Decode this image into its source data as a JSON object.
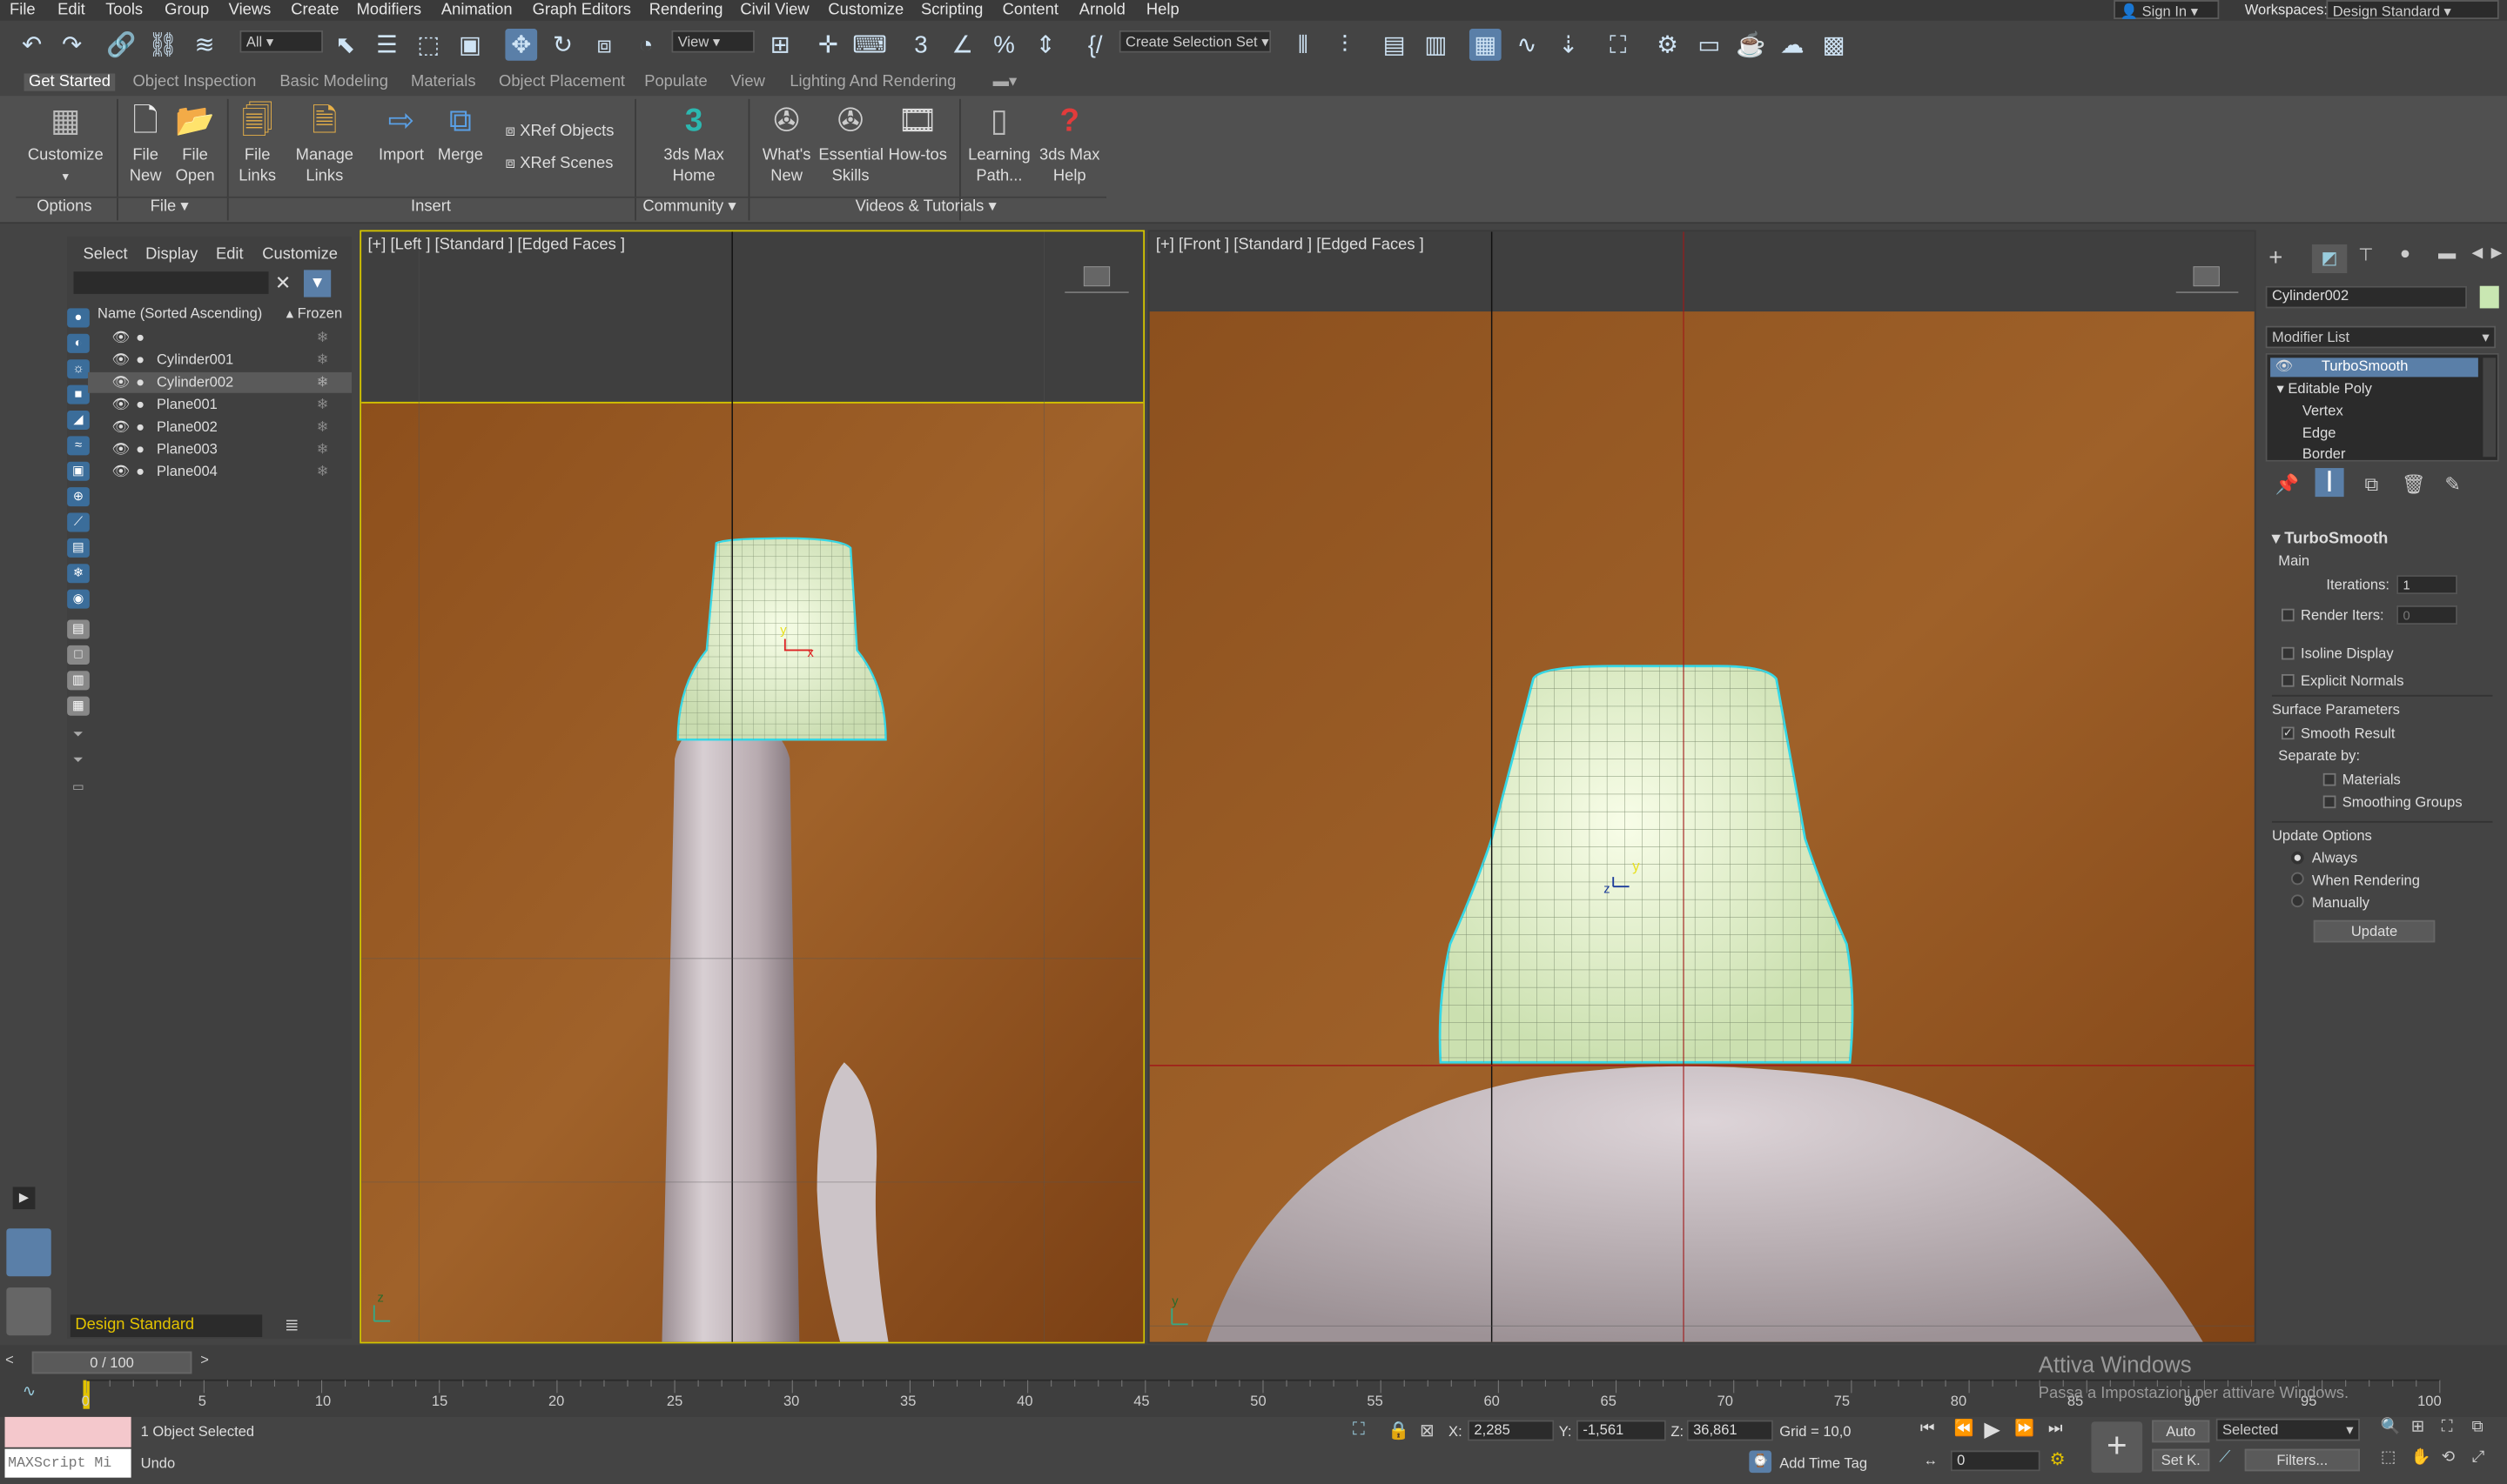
{
  "menu": [
    "File",
    "Edit",
    "Tools",
    "Group",
    "Views",
    "Create",
    "Modifiers",
    "Animation",
    "Graph Editors",
    "Rendering",
    "Civil View",
    "Customize",
    "Scripting",
    "Content",
    "Arnold",
    "Help"
  ],
  "account": {
    "sign_in": "Sign In",
    "workspaces_label": "Workspaces:",
    "workspace": "Design Standard"
  },
  "toolbar": {
    "filter_all": "All",
    "view": "View",
    "selection_set": "Create Selection Set"
  },
  "ribbon_tabs": [
    "Get Started",
    "Object Inspection",
    "Basic Modeling",
    "Materials",
    "Object Placement",
    "Populate",
    "View",
    "Lighting And Rendering"
  ],
  "ribbon": {
    "customize": "Customize",
    "file_new_1": "File",
    "file_new_2": "New",
    "file_open_1": "File",
    "file_open_2": "Open",
    "file_links_1": "File",
    "file_links_2": "Links",
    "manage_links_1": "Manage",
    "manage_links_2": "Links",
    "import": "Import",
    "merge": "Merge",
    "xref_objects": "XRef Objects",
    "xref_scenes": "XRef Scenes",
    "home_1": "3ds Max",
    "home_2": "Home",
    "whats_new_1": "What's",
    "whats_new_2": "New",
    "skills_1": "Essential",
    "skills_2": "Skills",
    "howtos": "How-tos",
    "learning_1": "Learning",
    "learning_2": "Path...",
    "help_1": "3ds Max",
    "help_2": "Help",
    "groups": {
      "options": "Options",
      "file": "File",
      "insert": "Insert",
      "community": "Community",
      "videos": "Videos & Tutorials"
    }
  },
  "scene_explorer": {
    "menu": [
      "Select",
      "Display",
      "Edit",
      "Customize"
    ],
    "col_name": "Name (Sorted Ascending)",
    "col_frozen": "Frozen",
    "items": [
      "",
      "Cylinder001",
      "Cylinder002",
      "Plane001",
      "Plane002",
      "Plane003",
      "Plane004"
    ],
    "workspace": "Design Standard"
  },
  "viewports": {
    "left": "[+] [Left ] [Standard ] [Edged Faces ]",
    "front": "[+] [Front ] [Standard ] [Edged Faces ]"
  },
  "command_panel": {
    "object_name": "Cylinder002",
    "modifier_list": "Modifier List",
    "stack": [
      "TurboSmooth",
      "Editable Poly",
      "Vertex",
      "Edge",
      "Border"
    ],
    "rollout_title": "TurboSmooth",
    "main": "Main",
    "iterations_label": "Iterations:",
    "iterations": "1",
    "render_iters_label": "Render Iters:",
    "render_iters": "0",
    "isoline": "Isoline Display",
    "explicit_normals": "Explicit Normals",
    "surface_params": "Surface Parameters",
    "smooth_result": "Smooth Result",
    "separate_by": "Separate by:",
    "materials": "Materials",
    "smoothing_groups": "Smoothing Groups",
    "update_options": "Update Options",
    "always": "Always",
    "when_rendering": "When Rendering",
    "manually": "Manually",
    "update_btn": "Update"
  },
  "timeline": {
    "frame": "0 / 100",
    "ticks": [
      "0",
      "5",
      "10",
      "15",
      "20",
      "25",
      "30",
      "35",
      "40",
      "45",
      "50",
      "55",
      "60",
      "65",
      "70",
      "75",
      "80",
      "85",
      "90",
      "95",
      "100"
    ]
  },
  "status": {
    "maxscript": "MAXScript Mi",
    "selected": "1 Object Selected",
    "undo": "Undo",
    "x_label": "X:",
    "x": "2,285",
    "y_label": "Y:",
    "y": "-1,561",
    "z_label": "Z:",
    "z": "36,861",
    "grid": "Grid = 10,0",
    "add_time_tag": "Add Time Tag",
    "auto": "Auto",
    "selected_dd": "Selected",
    "set_key": "Set K.",
    "filters": "Filters...",
    "frame_field": "0",
    "watermark_1": "Attiva Windows",
    "watermark_2": "Passa a Impostazioni per attivare Windows."
  },
  "colors": {
    "accent": "#5a7fa8",
    "selection_yellow": "#d4c400",
    "mesh": "#dcefc4",
    "backdrop": "#9a5b24"
  }
}
